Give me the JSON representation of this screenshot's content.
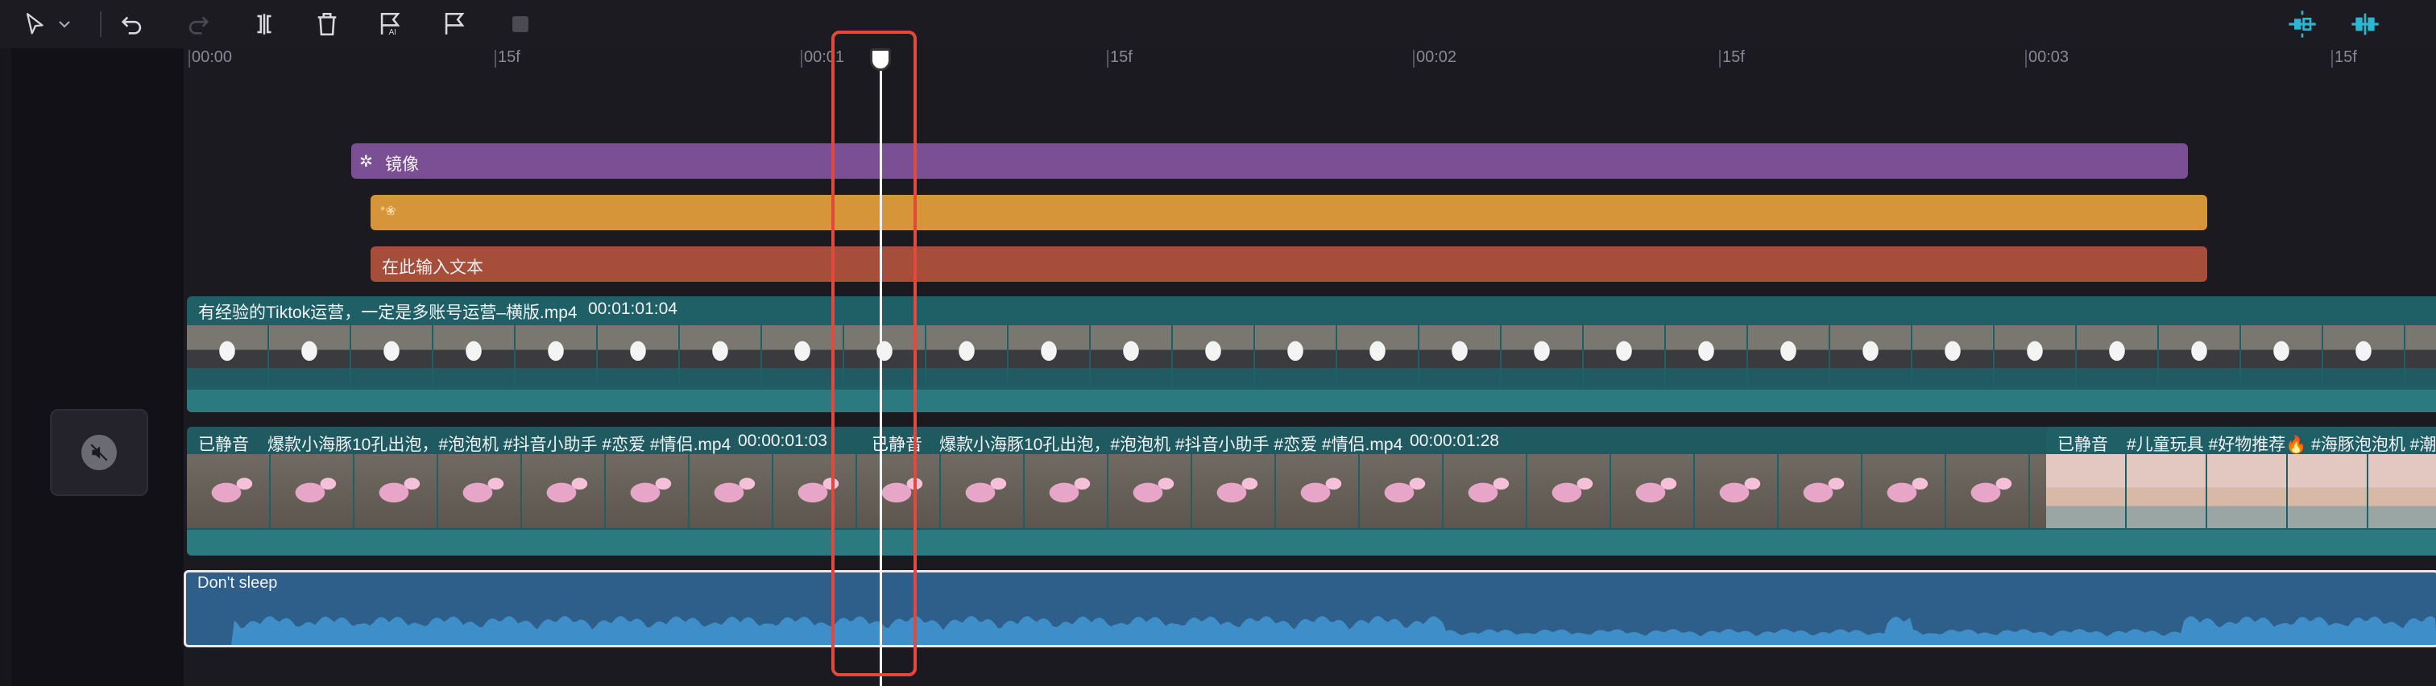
{
  "toolbar": {
    "tools": [
      {
        "name": "select-icon"
      },
      {
        "name": "undo-icon"
      },
      {
        "name": "redo-icon"
      },
      {
        "name": "split-icon"
      },
      {
        "name": "delete-icon"
      },
      {
        "name": "auto-caption-icon"
      },
      {
        "name": "marker-icon"
      }
    ],
    "right_tools": [
      {
        "name": "snap-icon"
      },
      {
        "name": "link-icon"
      }
    ]
  },
  "ruler": {
    "labels": [
      "00:00",
      "15f",
      "00:01",
      "15f",
      "00:02",
      "15f",
      "00:03",
      "15f"
    ]
  },
  "tracks": {
    "effect": {
      "label": "镜像"
    },
    "sticker": {
      "label": "*❀"
    },
    "text": {
      "label": "在此输入文本"
    },
    "video_main": {
      "name": "有经验的Tiktok运营，一定是多账号运营–横版.mp4",
      "duration": "00:01:01:04"
    },
    "video_b1": {
      "muted": "已静音",
      "name": "爆款小海豚10孔出泡，#泡泡机 #抖音小助手 #恋爱 #情侣.mp4",
      "duration": "00:00:01:03"
    },
    "video_b2": {
      "muted": "已静音",
      "name": "爆款小海豚10孔出泡，#泡泡机 #抖音小助手 #恋爱 #情侣.mp4",
      "duration": "00:00:01:28"
    },
    "video_c": {
      "muted": "已静音",
      "name": "#儿童玩具 #好物推荐🔥 #海豚泡泡机 #潮玩"
    },
    "audio": {
      "label": "Don't sleep"
    }
  },
  "colors": {
    "accent": "#e5483a",
    "effect": "#7a4f93",
    "sticker": "#d7953a",
    "text": "#a64e3a",
    "video": "#1f5f66",
    "audio": "#2e5f8a"
  }
}
